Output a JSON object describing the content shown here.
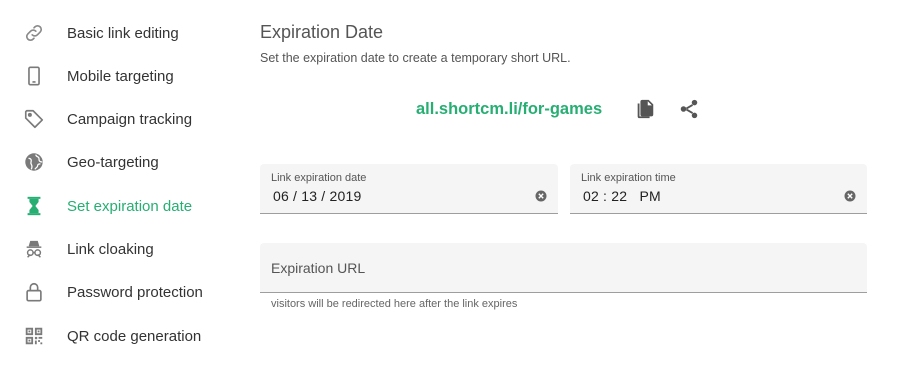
{
  "sidebar": {
    "items": [
      {
        "label": "Basic link editing",
        "icon": "link-icon"
      },
      {
        "label": "Mobile targeting",
        "icon": "phone-icon"
      },
      {
        "label": "Campaign tracking",
        "icon": "tag-icon"
      },
      {
        "label": "Geo-targeting",
        "icon": "globe-icon"
      },
      {
        "label": "Set expiration date",
        "icon": "hourglass-icon",
        "active": true
      },
      {
        "label": "Link cloaking",
        "icon": "incognito-icon"
      },
      {
        "label": "Password protection",
        "icon": "lock-icon"
      },
      {
        "label": "QR code generation",
        "icon": "qr-code-icon"
      }
    ]
  },
  "main": {
    "title": "Expiration Date",
    "subtitle": "Set the expiration date to create a temporary short URL.",
    "short_url": "all.shortcm.li/for-games",
    "date_field": {
      "label": "Link expiration date",
      "value": "06 / 13 / 2019"
    },
    "time_field": {
      "label": "Link expiration time",
      "value": "02 : 22   PM"
    },
    "url_field": {
      "placeholder": "Expiration URL",
      "hint": "visitors will be redirected here after the link expires"
    }
  },
  "colors": {
    "accent": "#27ae73",
    "icon_gray": "#7a7a7a",
    "field_bg": "#f5f5f5"
  }
}
